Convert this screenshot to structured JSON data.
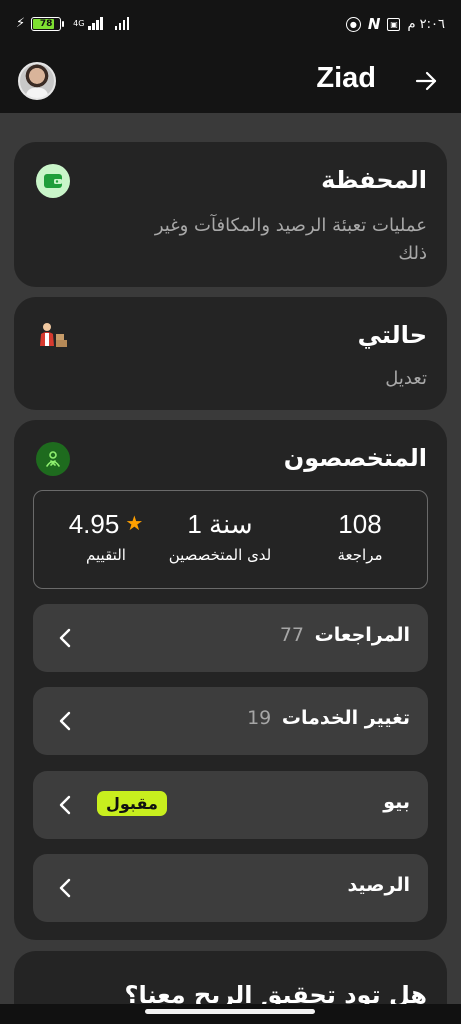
{
  "status_bar": {
    "battery_level": "78",
    "network": "4G",
    "time": "٢:٠٦ م"
  },
  "header": {
    "username": "Ziad",
    "avatar_icon": "avatar",
    "back_icon": "arrow-right-icon"
  },
  "wallet": {
    "title": "المحفظة",
    "subtitle_line1": "عمليات تعبئة الرصيد والمكافآت وغير",
    "subtitle_line2": "ذلك",
    "icon": "wallet-icon",
    "icon_bg": "#c9f5c9"
  },
  "status_card": {
    "title": "حالتي",
    "subtitle": "تعديل",
    "icon": "person-with-boxes-icon"
  },
  "specialists": {
    "title": "المتخصصون",
    "icon": "specialist-icon",
    "icon_bg": "#1e6b1e",
    "stats": {
      "reviews_value": "108",
      "reviews_label": "مراجعة",
      "tenure_value": "1 سنة",
      "tenure_label": "لدى المتخصصين",
      "rating_value": "4.95",
      "rating_label": "التقييم",
      "star_color": "#ffa000"
    },
    "rows": [
      {
        "label": "المراجعات",
        "count": "77"
      },
      {
        "label": "تغيير الخدمات",
        "count": "19"
      },
      {
        "label": "بيو",
        "badge": "مقبول",
        "badge_color": "#c8ef1e"
      },
      {
        "label": "الرصيد"
      }
    ]
  },
  "promo": {
    "title": "هل تود تحقيق الربح معنا؟"
  }
}
